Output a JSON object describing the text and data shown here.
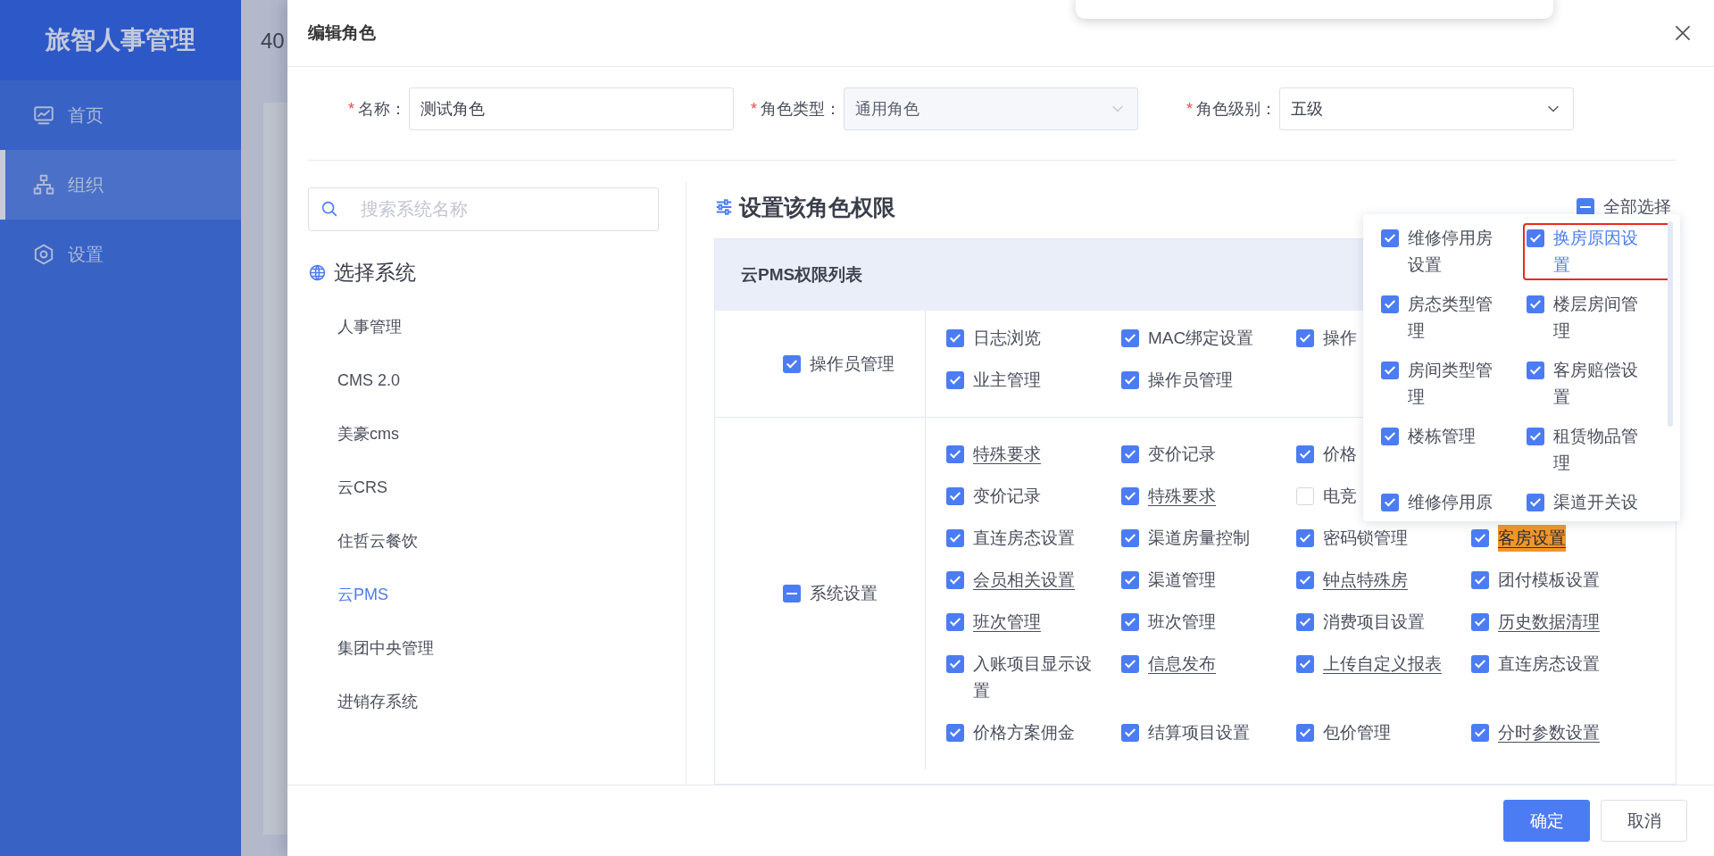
{
  "app": {
    "title": "旅智人事管理"
  },
  "sidebar": {
    "items": [
      {
        "label": "首页",
        "selected": false
      },
      {
        "label": "组织",
        "selected": true
      },
      {
        "label": "设置",
        "selected": false
      }
    ]
  },
  "background": {
    "heading": "40"
  },
  "dialog": {
    "title": "编辑角色",
    "fields": [
      {
        "mark": "*",
        "label": "名称：",
        "kind": "text",
        "value": "测试角色",
        "disabled": false
      },
      {
        "mark": "*",
        "label": "角色类型：",
        "kind": "select",
        "value": "通用角色",
        "disabled": true
      },
      {
        "mark": "*",
        "label": "角色级别：",
        "kind": "select",
        "value": "五级",
        "disabled": false
      }
    ],
    "system_search": {
      "placeholder": "搜索系统名称"
    },
    "system_heading": "选择系统",
    "systems": [
      {
        "label": "人事管理",
        "selected": false
      },
      {
        "label": "CMS 2.0",
        "selected": false
      },
      {
        "label": "美豪cms",
        "selected": false
      },
      {
        "label": "云CRS",
        "selected": false
      },
      {
        "label": "住哲云餐饮",
        "selected": false
      },
      {
        "label": "云PMS",
        "selected": true
      },
      {
        "label": "集团中央管理",
        "selected": false
      },
      {
        "label": "进销存系统",
        "selected": false
      }
    ],
    "permissions": {
      "title": "设置该角色权限",
      "select_all": {
        "label": "全部选择",
        "indeterminate": true
      },
      "table_title": "云PMS权限列表",
      "groups": [
        {
          "label": "操作员管理",
          "checked": true,
          "rows": [
            [
              {
                "label": "日志浏览",
                "checked": true,
                "kind": "plain"
              },
              {
                "label": "MAC绑定设置",
                "checked": true,
                "kind": "plain"
              },
              {
                "label": "操作",
                "checked": true,
                "kind": "plain"
              }
            ],
            [
              {
                "label": "业主管理",
                "checked": true,
                "kind": "plain"
              },
              {
                "label": "操作员管理",
                "checked": true,
                "kind": "plain"
              }
            ]
          ]
        },
        {
          "label": "系统设置",
          "indeterminate": true,
          "rows": [
            [
              {
                "label": "特殊要求",
                "checked": true,
                "kind": "link"
              },
              {
                "label": "变价记录",
                "checked": true,
                "kind": "plain"
              },
              {
                "label": "价格",
                "checked": true,
                "kind": "plain"
              }
            ],
            [
              {
                "label": "变价记录",
                "checked": true,
                "kind": "plain"
              },
              {
                "label": "特殊要求",
                "checked": true,
                "kind": "link"
              },
              {
                "label": "电竞",
                "checked": false,
                "kind": "plain"
              }
            ],
            [
              {
                "label": "直连房态设置",
                "checked": true,
                "kind": "plain"
              },
              {
                "label": "渠道房量控制",
                "checked": true,
                "kind": "plain"
              },
              {
                "label": "密码锁管理",
                "checked": true,
                "kind": "plain"
              },
              {
                "label": "客房设置",
                "checked": true,
                "kind": "marked"
              }
            ],
            [
              {
                "label": "会员相关设置",
                "checked": true,
                "kind": "link"
              },
              {
                "label": "渠道管理",
                "checked": true,
                "kind": "plain"
              },
              {
                "label": "钟点特殊房",
                "checked": true,
                "kind": "link"
              },
              {
                "label": "团付模板设置",
                "checked": true,
                "kind": "plain"
              }
            ],
            [
              {
                "label": "班次管理",
                "checked": true,
                "kind": "link"
              },
              {
                "label": "班次管理",
                "checked": true,
                "kind": "plain"
              },
              {
                "label": "消费项目设置",
                "checked": true,
                "kind": "plain"
              },
              {
                "label": "历史数据清理",
                "checked": true,
                "kind": "link"
              }
            ],
            [
              {
                "label": "入账项目显示设置",
                "checked": true,
                "kind": "plain"
              },
              {
                "label": "信息发布",
                "checked": true,
                "kind": "link"
              },
              {
                "label": "上传自定义报表",
                "checked": true,
                "kind": "link"
              },
              {
                "label": "直连房态设置",
                "checked": true,
                "kind": "plain"
              }
            ],
            [
              {
                "label": "价格方案佣金",
                "checked": true,
                "kind": "plain"
              },
              {
                "label": "结算项目设置",
                "checked": true,
                "kind": "plain"
              },
              {
                "label": "包价管理",
                "checked": true,
                "kind": "plain"
              },
              {
                "label": "分时参数设置",
                "checked": true,
                "kind": "link"
              }
            ]
          ]
        }
      ]
    },
    "popover": {
      "items": [
        {
          "label": "维修停用房设置",
          "checked": true,
          "kind": "plain"
        },
        {
          "label": "换房原因设置",
          "checked": true,
          "kind": "focused"
        },
        {
          "label": "房态类型管理",
          "checked": true,
          "kind": "plain"
        },
        {
          "label": "楼层房间管理",
          "checked": true,
          "kind": "plain"
        },
        {
          "label": "房间类型管理",
          "checked": true,
          "kind": "plain"
        },
        {
          "label": "客房赔偿设置",
          "checked": true,
          "kind": "plain"
        },
        {
          "label": "楼栋管理",
          "checked": true,
          "kind": "plain"
        },
        {
          "label": "租赁物品管理",
          "checked": true,
          "kind": "plain"
        },
        {
          "label": "维修停用原",
          "checked": true,
          "kind": "plain"
        },
        {
          "label": "渠道开关设",
          "checked": true,
          "kind": "plain"
        }
      ]
    },
    "buttons": [
      {
        "label": "确定",
        "kind": "primary"
      },
      {
        "label": "取消",
        "kind": "default"
      }
    ]
  }
}
